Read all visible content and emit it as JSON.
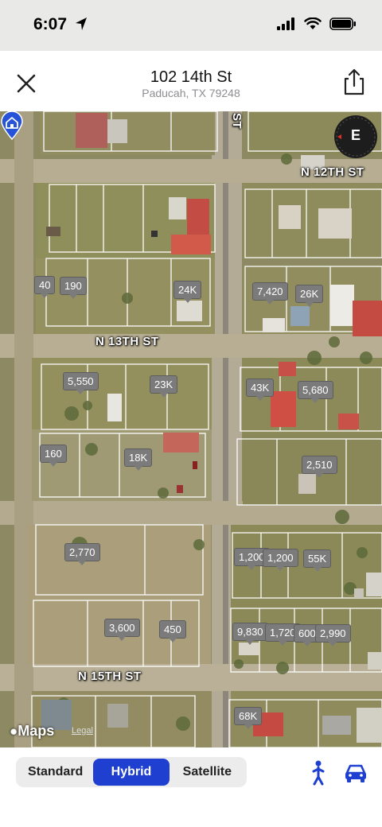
{
  "status": {
    "time": "6:07",
    "icons": [
      "location-arrow-icon",
      "signal-icon",
      "wifi-icon",
      "battery-icon"
    ]
  },
  "header": {
    "title": "102 14th St",
    "subtitle": "Paducah, TX 79248",
    "close_icon": "close-icon",
    "share_icon": "share-icon"
  },
  "map": {
    "compass": "E",
    "streets": {
      "n12": "N 12TH ST",
      "n13": "N 13TH ST",
      "n15": "N 15TH ST",
      "st": "ST"
    },
    "pins": [
      "40",
      "190",
      "24K",
      "7,420",
      "26K",
      "5,550",
      "23K",
      "43K",
      "5,680",
      "160",
      "18K",
      "2,510",
      "2,770",
      "1,200",
      "1,200",
      "55K",
      "3,600",
      "450",
      "9,830",
      "1,720",
      "600",
      "2,990",
      "68K"
    ],
    "attribution": {
      "logo": "Maps",
      "legal": "Legal"
    }
  },
  "map_types": {
    "standard": "Standard",
    "hybrid": "Hybrid",
    "satellite": "Satellite",
    "selected": "Hybrid"
  },
  "colors": {
    "accent": "#1e3fd0",
    "pin": "#7b7b7b"
  },
  "actions": {
    "walk_icon": "walking-person-icon",
    "car_icon": "car-icon"
  }
}
